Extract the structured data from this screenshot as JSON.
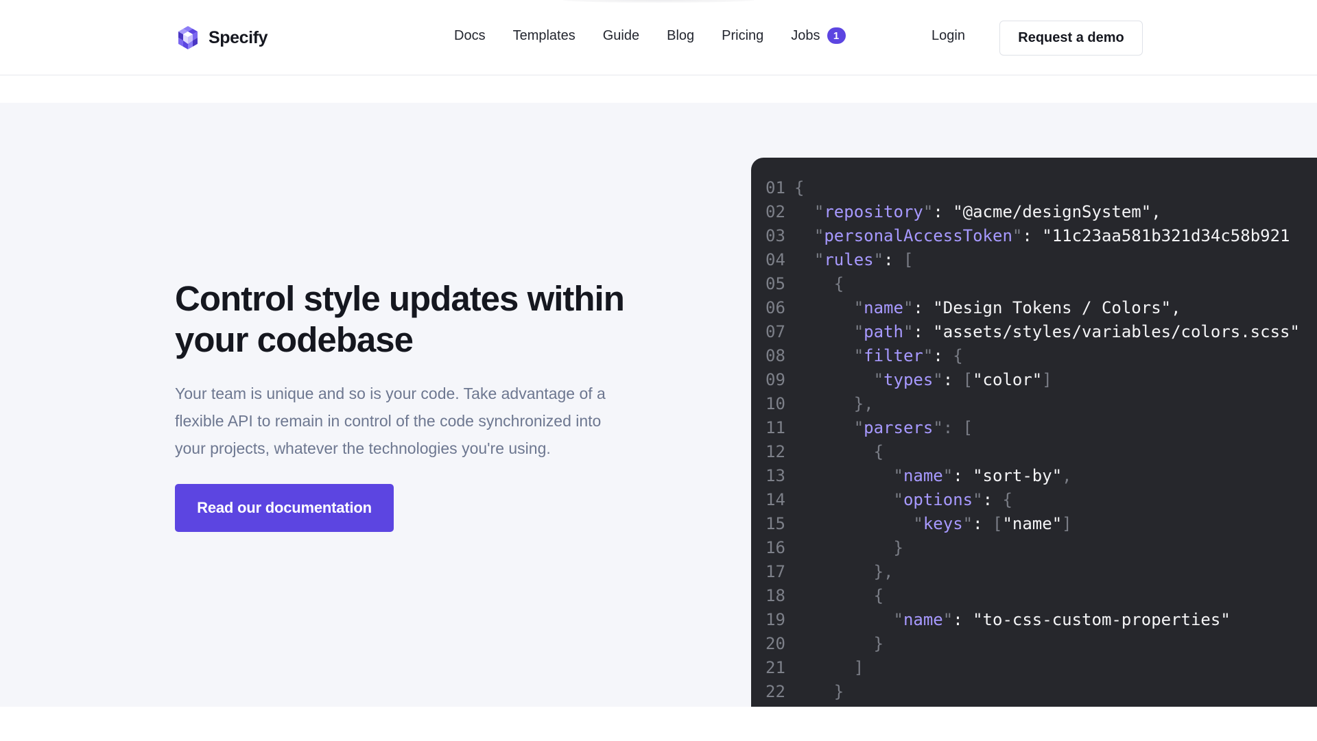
{
  "header": {
    "logo_text": "Specify",
    "nav": [
      {
        "label": "Docs"
      },
      {
        "label": "Templates"
      },
      {
        "label": "Guide"
      },
      {
        "label": "Blog"
      },
      {
        "label": "Pricing"
      },
      {
        "label": "Jobs",
        "badge": "1"
      }
    ],
    "login_label": "Login",
    "demo_label": "Request a demo"
  },
  "hero": {
    "title": "Control style updates within your codebase",
    "description": "Your team is unique and so is your code. Take advantage of a flexible API to remain in control of the code synchronized into your projects, whatever the technologies you're using.",
    "cta_label": "Read our documentation"
  },
  "code": {
    "line_numbers": [
      "01",
      "02",
      "03",
      "04",
      "05",
      "06",
      "07",
      "08",
      "09",
      "10",
      "11",
      "12",
      "13",
      "14",
      "15",
      "16",
      "17",
      "18",
      "19",
      "20",
      "21",
      "22"
    ],
    "lines": [
      [
        [
          "p",
          "{"
        ]
      ],
      [
        [
          "s",
          "  "
        ],
        [
          "p",
          "\""
        ],
        [
          "k",
          "repository"
        ],
        [
          "p",
          "\""
        ],
        [
          "s",
          ": \"@acme/designSystem\","
        ]
      ],
      [
        [
          "s",
          "  "
        ],
        [
          "p",
          "\""
        ],
        [
          "k",
          "personalAccessToken"
        ],
        [
          "p",
          "\""
        ],
        [
          "s",
          ": \"11c23aa581b321d34c58b921"
        ]
      ],
      [
        [
          "s",
          "  "
        ],
        [
          "p",
          "\""
        ],
        [
          "k",
          "rules"
        ],
        [
          "p",
          "\""
        ],
        [
          "s",
          ": "
        ],
        [
          "p",
          "["
        ]
      ],
      [
        [
          "s",
          "    "
        ],
        [
          "p",
          "{"
        ]
      ],
      [
        [
          "s",
          "      "
        ],
        [
          "p",
          "\""
        ],
        [
          "k",
          "name"
        ],
        [
          "p",
          "\""
        ],
        [
          "s",
          ": \"Design Tokens / Colors\","
        ]
      ],
      [
        [
          "s",
          "      "
        ],
        [
          "p",
          "\""
        ],
        [
          "k",
          "path"
        ],
        [
          "p",
          "\""
        ],
        [
          "s",
          ": \"assets/styles/variables/colors.scss\""
        ]
      ],
      [
        [
          "s",
          "      "
        ],
        [
          "p",
          "\""
        ],
        [
          "k",
          "filter"
        ],
        [
          "p",
          "\""
        ],
        [
          "s",
          ": "
        ],
        [
          "p",
          "{"
        ]
      ],
      [
        [
          "s",
          "        "
        ],
        [
          "p",
          "\""
        ],
        [
          "k",
          "types"
        ],
        [
          "p",
          "\""
        ],
        [
          "s",
          ": "
        ],
        [
          "p",
          "["
        ],
        [
          "s",
          "\"color\""
        ],
        [
          "p",
          "]"
        ]
      ],
      [
        [
          "s",
          "      "
        ],
        [
          "p",
          "},"
        ]
      ],
      [
        [
          "s",
          "      "
        ],
        [
          "p",
          "\""
        ],
        [
          "k",
          "parsers"
        ],
        [
          "p",
          "\": ["
        ]
      ],
      [
        [
          "s",
          "        "
        ],
        [
          "p",
          "{"
        ]
      ],
      [
        [
          "s",
          "          "
        ],
        [
          "p",
          "\""
        ],
        [
          "k",
          "name"
        ],
        [
          "p",
          "\""
        ],
        [
          "s",
          ": \"sort-by\""
        ],
        [
          "p",
          ","
        ]
      ],
      [
        [
          "s",
          "          "
        ],
        [
          "p",
          "\""
        ],
        [
          "k",
          "options"
        ],
        [
          "p",
          "\""
        ],
        [
          "s",
          ": "
        ],
        [
          "p",
          "{"
        ]
      ],
      [
        [
          "s",
          "            "
        ],
        [
          "p",
          "\""
        ],
        [
          "k",
          "keys"
        ],
        [
          "p",
          "\""
        ],
        [
          "s",
          ": "
        ],
        [
          "p",
          "["
        ],
        [
          "s",
          "\"name\""
        ],
        [
          "p",
          "]"
        ]
      ],
      [
        [
          "s",
          "          "
        ],
        [
          "p",
          "}"
        ]
      ],
      [
        [
          "s",
          "        "
        ],
        [
          "p",
          "},"
        ]
      ],
      [
        [
          "s",
          "        "
        ],
        [
          "p",
          "{"
        ]
      ],
      [
        [
          "s",
          "          "
        ],
        [
          "p",
          "\""
        ],
        [
          "k",
          "name"
        ],
        [
          "p",
          "\""
        ],
        [
          "s",
          ": \"to-css-custom-properties\""
        ]
      ],
      [
        [
          "s",
          "        "
        ],
        [
          "p",
          "}"
        ]
      ],
      [
        [
          "s",
          "      "
        ],
        [
          "p",
          "]"
        ]
      ],
      [
        [
          "s",
          "    "
        ],
        [
          "p",
          "}"
        ]
      ]
    ]
  },
  "colors": {
    "accent": "#5c45e1",
    "code_background": "#26272c",
    "code_key": "#a799ff",
    "code_punctuation": "#7a7d86",
    "hero_background": "#f5f6fa"
  },
  "icons": {
    "logo": "specify-logo-icon"
  }
}
